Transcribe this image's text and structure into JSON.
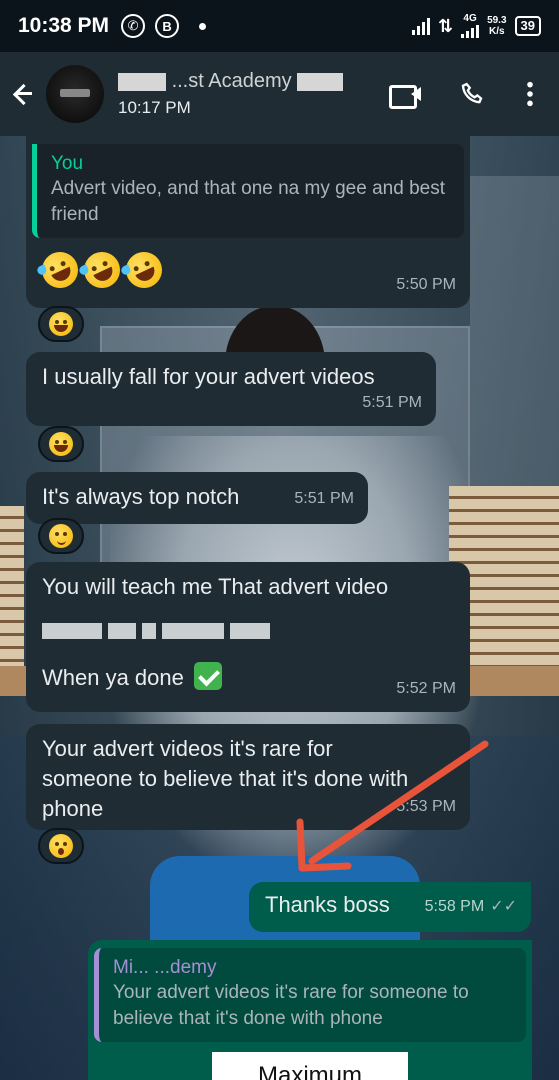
{
  "status_bar": {
    "time": "10:38 PM",
    "whatsapp_icon": "whatsapp-icon",
    "b_icon_label": "B",
    "network": "4G",
    "speed_value": "59.3",
    "speed_unit": "K/s",
    "battery": "39"
  },
  "header": {
    "back_icon": "arrow-back-icon",
    "contact_name_visible": "...st Academy",
    "last_seen": "10:17 PM",
    "video_icon": "video-call-icon",
    "call_icon": "phone-icon",
    "more_icon": "more-vert-icon"
  },
  "messages": [
    {
      "direction": "in",
      "quote_name": "You",
      "quote_text": "Advert video, and that one na my gee and best friend",
      "emoji": [
        "rolling-laughing",
        "rolling-laughing",
        "rolling-laughing"
      ],
      "time": "5:50 PM",
      "reaction": "joy"
    },
    {
      "direction": "in",
      "text": "I usually fall for your advert videos",
      "time": "5:51 PM",
      "reaction": "joy"
    },
    {
      "direction": "in",
      "text": "It's always top notch",
      "time": "5:51 PM",
      "reaction": "woozy"
    },
    {
      "direction": "in",
      "text": "You will teach me That  advert video",
      "text_after": "When ya done",
      "emoji_after": "check-mark",
      "time": "5:52 PM"
    },
    {
      "direction": "in",
      "text": "Your advert videos it's rare for someone to believe that it's done with phone",
      "time": "5:53 PM",
      "reaction": "astonished"
    },
    {
      "direction": "out",
      "text": "Thanks boss",
      "time": "5:58 PM",
      "status": "read"
    },
    {
      "direction": "out",
      "quote_name": "Mi... ...demy",
      "quote_text": "Your advert videos it's rare for someone to believe that it's done with phone",
      "preview_text": "Maximum"
    }
  ],
  "colors": {
    "incoming_bubble": "#1f2c34",
    "outgoing_bubble": "#005c4b",
    "quote_accent_you": "#06cf9c",
    "quote_accent_other": "#a590d6",
    "annotation_arrow": "#e8543a"
  }
}
